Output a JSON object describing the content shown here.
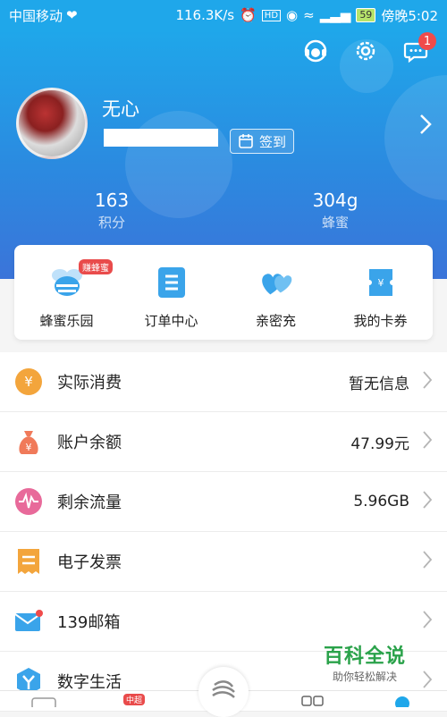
{
  "status": {
    "carrier": "中国移动",
    "speed": "116.3K/s",
    "battery": "59",
    "time": "傍晚5:02"
  },
  "header": {
    "username": "无心",
    "signin_label": "签到",
    "message_count": "1",
    "stats": [
      {
        "value": "163",
        "label": "积分"
      },
      {
        "value": "304g",
        "label": "蜂蜜"
      }
    ]
  },
  "quick": {
    "items": [
      {
        "label": "蜂蜜乐园",
        "tag": "赚蜂蜜"
      },
      {
        "label": "订单中心"
      },
      {
        "label": "亲密充"
      },
      {
        "label": "我的卡券"
      }
    ]
  },
  "list": {
    "rows": [
      {
        "label": "实际消费",
        "value": "暂无信息"
      },
      {
        "label": "账户余额",
        "value": "47.99元"
      },
      {
        "label": "剩余流量",
        "value": "5.96GB"
      },
      {
        "label": "电子发票",
        "value": ""
      },
      {
        "label": "139邮箱",
        "value": ""
      },
      {
        "label": "数字生活",
        "value": ""
      }
    ]
  },
  "watermark": {
    "title": "百科全说",
    "subtitle": "助你轻松解决"
  },
  "tabbar": {
    "badge": "中超"
  },
  "colors": {
    "header_top": "#1fa7ea",
    "header_bottom": "#3b74d9",
    "badge_red": "#f04b4b",
    "icon_blue": "#3aa4ea",
    "icon_orange": "#f3a53c"
  }
}
